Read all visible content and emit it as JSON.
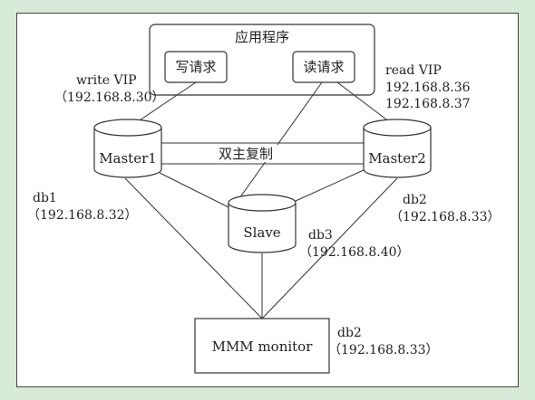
{
  "app": {
    "title": "应用程序",
    "write_request": "写请求",
    "read_request": "读请求"
  },
  "write_vip": {
    "label": "write VIP",
    "ip": "（192.168.8.30）"
  },
  "read_vip": {
    "label": "read VIP",
    "ip1": "192.168.8.36",
    "ip2": "192.168.8.37"
  },
  "master1": {
    "name": "Master1",
    "db": "db1",
    "ip": "（192.168.8.32）"
  },
  "master2": {
    "name": "Master2",
    "db": "db2",
    "ip": "（192.168.8.33）"
  },
  "replication": {
    "label": "双主复制"
  },
  "slave": {
    "name": "Slave",
    "db": "db3",
    "ip": "（192.168.8.40）"
  },
  "monitor": {
    "name": "MMM monitor",
    "db": "db2",
    "ip": "（192.168.8.33）"
  },
  "colors": {
    "background": "#d7ead8",
    "stroke": "#333333"
  }
}
